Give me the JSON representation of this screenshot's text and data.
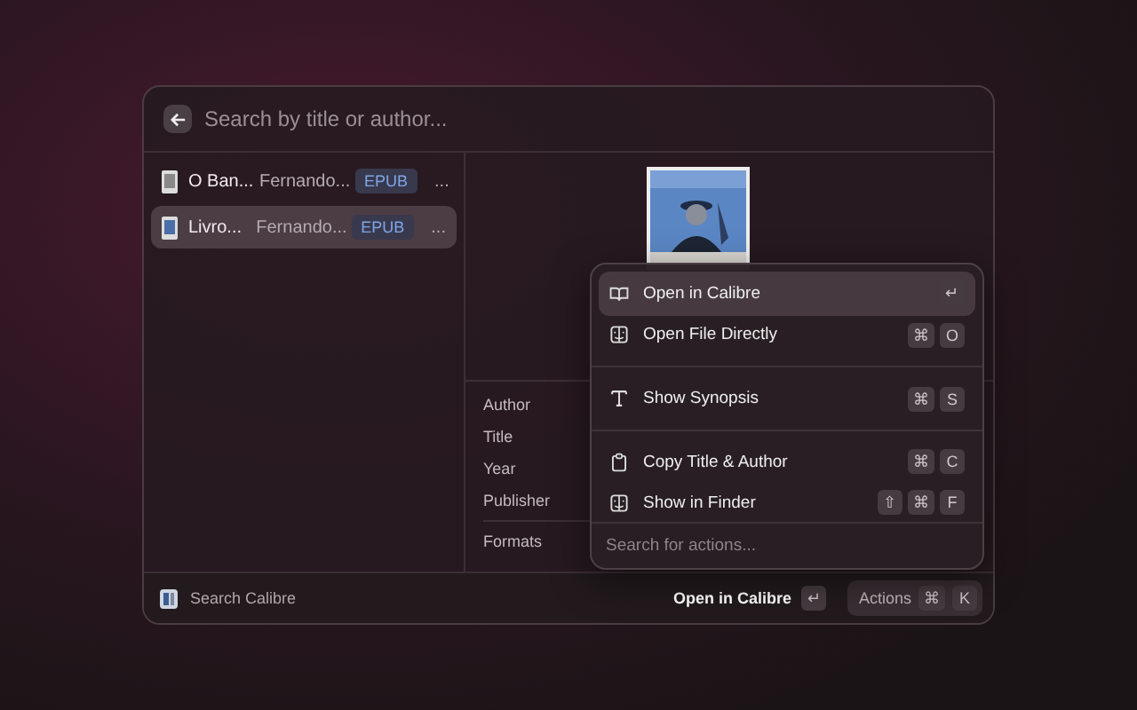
{
  "search": {
    "placeholder": "Search by title or author..."
  },
  "books": [
    {
      "title": "O Ban...",
      "author": "Fernando...",
      "format": "EPUB",
      "more": "...",
      "selected": false
    },
    {
      "title": "Livro...",
      "author": "Fernando...",
      "format": "EPUB",
      "more": "...",
      "selected": true
    }
  ],
  "details": {
    "fields": [
      {
        "label": "Author"
      },
      {
        "label": "Title"
      },
      {
        "label": "Year"
      },
      {
        "label": "Publisher"
      },
      {
        "label": "Formats",
        "kind": "separated"
      }
    ]
  },
  "actions": {
    "items": [
      {
        "kind": "book",
        "label": "Open in Calibre",
        "keys": [
          "↵"
        ],
        "selected": true
      },
      {
        "kind": "finder",
        "label": "Open File Directly",
        "keys": [
          "⌘",
          "O"
        ],
        "selected": false
      },
      {
        "kind": "divider"
      },
      {
        "kind": "text",
        "label": "Show Synopsis",
        "keys": [
          "⌘",
          "S"
        ],
        "selected": false
      },
      {
        "kind": "divider"
      },
      {
        "kind": "clipboard",
        "label": "Copy Title & Author",
        "keys": [
          "⌘",
          "C"
        ],
        "selected": false
      },
      {
        "kind": "finder",
        "label": "Show in Finder",
        "keys": [
          "⇧",
          "⌘",
          "F"
        ],
        "selected": false
      }
    ],
    "search": {
      "placeholder": "Search for actions..."
    }
  },
  "footer": {
    "title": "Search Calibre",
    "primary": "Open in Calibre",
    "primary_key": "↵",
    "actions": "Actions",
    "action_keys": [
      "⌘",
      "K"
    ]
  }
}
